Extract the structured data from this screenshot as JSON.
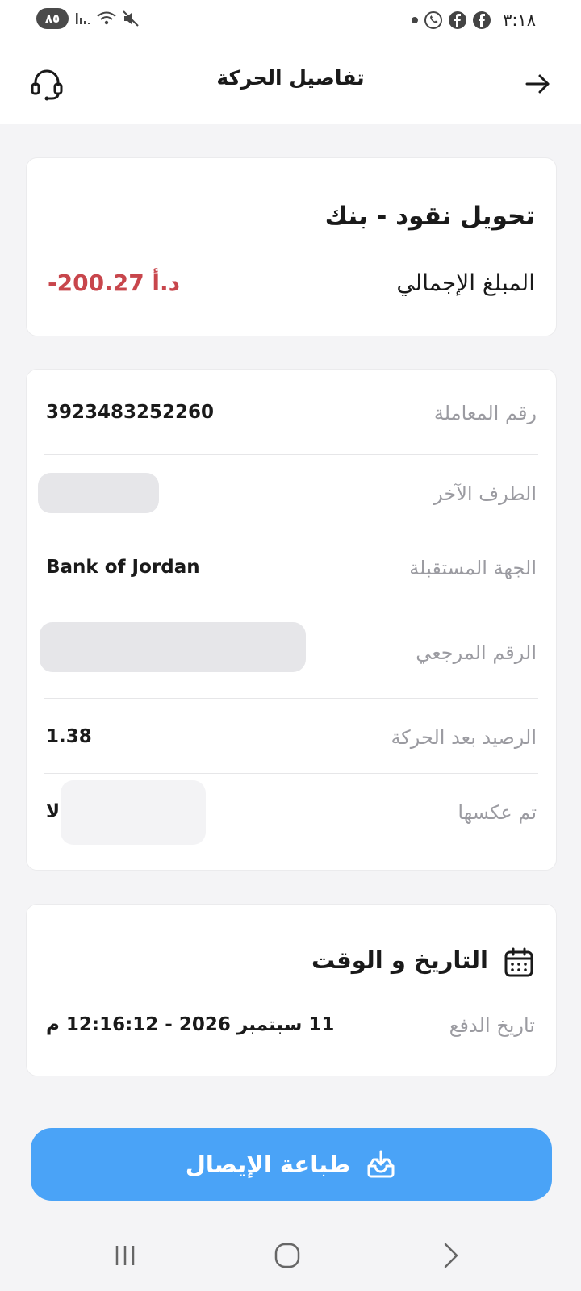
{
  "status_bar": {
    "battery": "٨٥",
    "time": "٣:١٨"
  },
  "header": {
    "title": "تفاصيل الحركة",
    "back_icon": "arrow-right-icon",
    "support_icon": "headset-icon"
  },
  "summary": {
    "transaction_type": "تحويل نقود - بنك",
    "total_label": "المبلغ الإجمالي",
    "total_amount": "-200.27 د.أ",
    "amount_color": "#c8464c"
  },
  "details": {
    "rows": [
      {
        "label": "رقم المعاملة",
        "value": "3923483252260"
      },
      {
        "label": "الطرف الآخر",
        "value": ""
      },
      {
        "label": "الجهة المستقبلة",
        "value": "Bank of Jordan"
      },
      {
        "label": "الرقم المرجعي",
        "value": ""
      },
      {
        "label": "الرصيد بعد الحركة",
        "value": "1.38"
      },
      {
        "label": "تم عكسها",
        "value": "لا"
      }
    ]
  },
  "datetime": {
    "title": "التاريخ و الوقت",
    "pay_date_label": "تاريخ الدفع",
    "pay_date_value": "11 سبتمبر 2026 - 12:16:12 م"
  },
  "actions": {
    "print_label": "طباعة الإيصال",
    "button_color": "#4aa3f7"
  }
}
